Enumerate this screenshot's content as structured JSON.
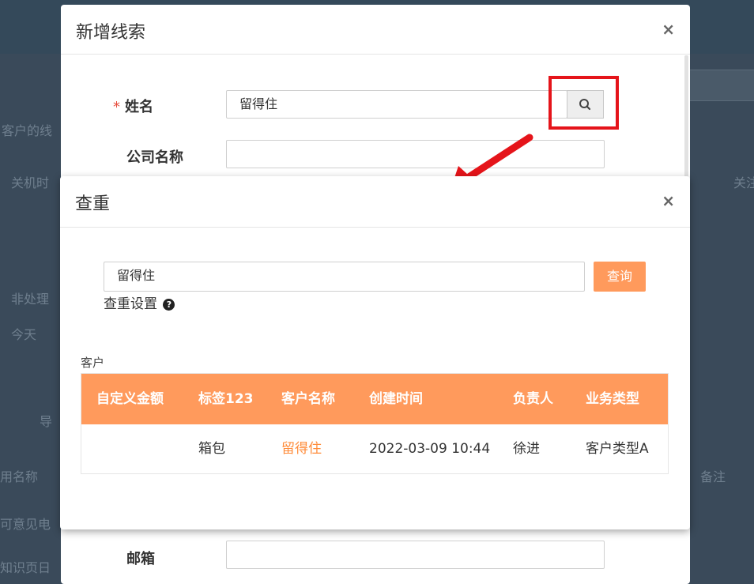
{
  "background": {
    "texts": [
      "客户的线",
      "关机时",
      "非处理",
      "今天",
      "导",
      "用名称",
      "可意见电",
      "知识页日",
      "备注",
      "关注"
    ]
  },
  "add_lead_dialog": {
    "title": "新增线索",
    "close_symbol": "×",
    "required_mark": "*",
    "name_label": "姓名",
    "name_value": "留得住",
    "company_label": "公司名称",
    "company_value": "",
    "email_label": "邮箱",
    "email_value": "",
    "search_icon": "search-icon"
  },
  "dedupe_dialog": {
    "title": "查重",
    "close_symbol": "×",
    "query_value": "留得住",
    "query_button": "查询",
    "settings_label": "查重设置",
    "help_icon": "?",
    "section_label": "客户",
    "table": {
      "headers": [
        "自定义金额",
        "标签123",
        "客户名称",
        "创建时间",
        "负责人",
        "业务类型"
      ],
      "rows": [
        [
          "",
          "箱包",
          "留得住",
          "2022-03-09 10:44",
          "徐进",
          "客户类型A"
        ]
      ]
    }
  },
  "colors": {
    "accent": "#ff9a5c",
    "highlight": "#e5141a",
    "overlay": "#3a4a5a"
  }
}
